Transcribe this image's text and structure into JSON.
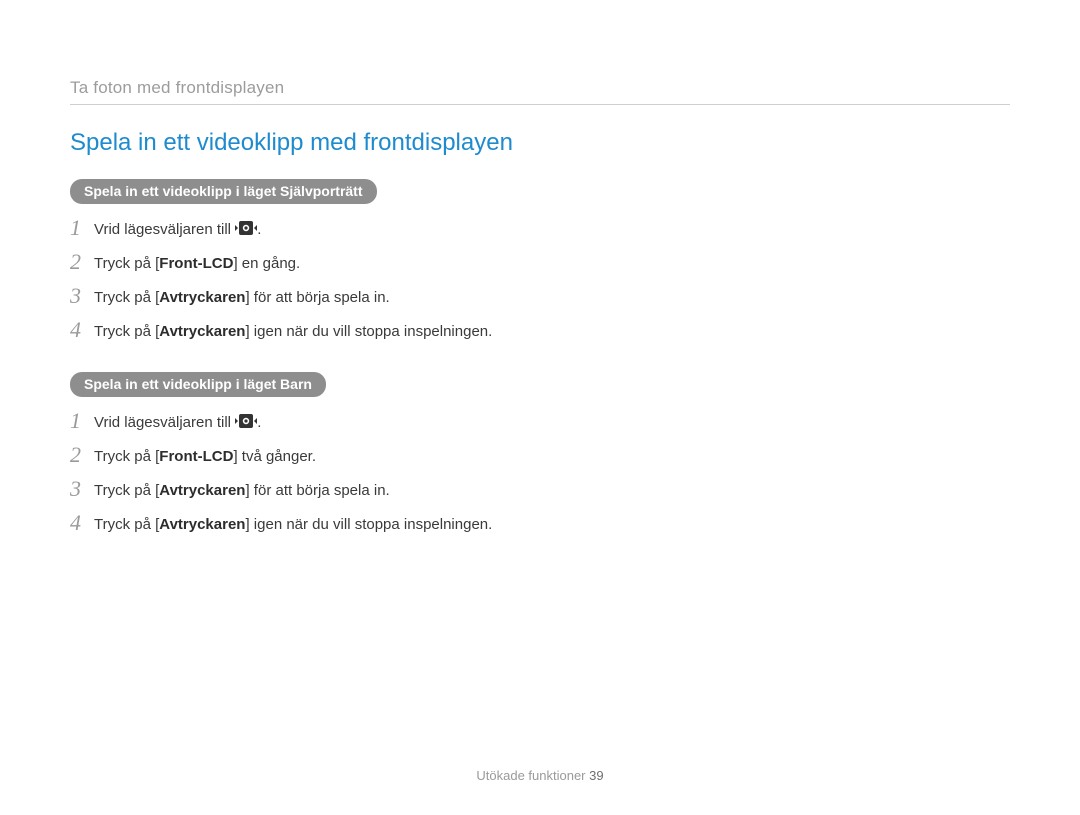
{
  "breadcrumb": "Ta foton med frontdisplayen",
  "title": "Spela in ett videoklipp med frontdisplayen",
  "sections": [
    {
      "pill": "Spela in ett videoklipp i läget Självporträtt",
      "steps": [
        {
          "pre": "Vrid lägesväljaren till ",
          "icon": "video",
          "post": "."
        },
        {
          "pre": "Tryck på [",
          "bold": "Front-LCD",
          "post": "] en gång."
        },
        {
          "pre": "Tryck på [",
          "bold": "Avtryckaren",
          "post": "] för att börja spela in."
        },
        {
          "pre": "Tryck på [",
          "bold": "Avtryckaren",
          "post": "] igen när du vill stoppa inspelningen."
        }
      ]
    },
    {
      "pill": "Spela in ett videoklipp i läget Barn",
      "steps": [
        {
          "pre": "Vrid lägesväljaren till ",
          "icon": "video",
          "post": "."
        },
        {
          "pre": "Tryck på [",
          "bold": "Front-LCD",
          "post": "] två gånger."
        },
        {
          "pre": "Tryck på [",
          "bold": "Avtryckaren",
          "post": "] för att börja spela in."
        },
        {
          "pre": "Tryck på [",
          "bold": "Avtryckaren",
          "post": "] igen när du vill stoppa inspelningen."
        }
      ]
    }
  ],
  "footer": {
    "label": "Utökade funktioner",
    "page": "39"
  }
}
